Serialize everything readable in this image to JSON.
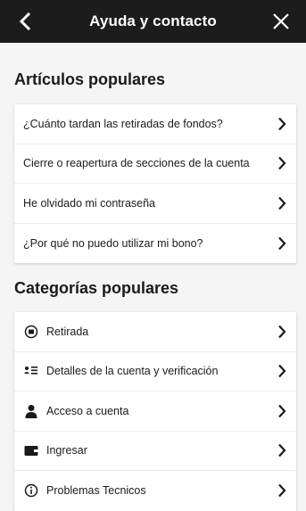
{
  "header": {
    "title": "Ayuda y contacto",
    "background": "#1c1c1c"
  },
  "popular_articles": {
    "title": "Artículos populares",
    "items": [
      {
        "label": "¿Cuánto tardan las retiradas de fondos?"
      },
      {
        "label": "Cierre o reapertura de secciones de la cuenta"
      },
      {
        "label": "He olvidado mi contraseña"
      },
      {
        "label": "¿Por qué no puedo utilizar mi bono?"
      }
    ]
  },
  "popular_categories": {
    "title": "Categorías populares",
    "items": [
      {
        "label": "Retirada",
        "icon": "withdrawal-icon"
      },
      {
        "label": "Detalles de la cuenta y verificación",
        "icon": "id-card-icon"
      },
      {
        "label": "Acceso a cuenta",
        "icon": "person-icon"
      },
      {
        "label": "Ingresar",
        "icon": "wallet-icon"
      },
      {
        "label": "Problemas Tecnicos",
        "icon": "info-icon"
      }
    ]
  }
}
